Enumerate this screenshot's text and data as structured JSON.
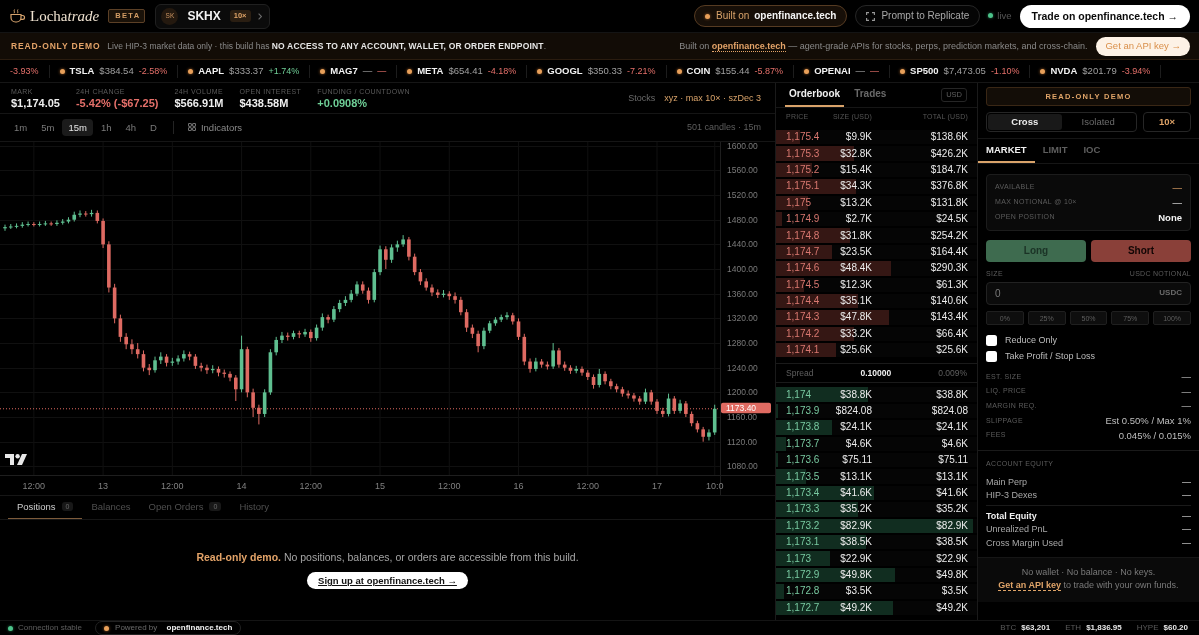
{
  "header": {
    "brand": {
      "upright": "Locha",
      "italic": "trade"
    },
    "badge": "BETA",
    "market": {
      "avatar": "SK",
      "symbol": "SKHX",
      "leverage": "10×"
    },
    "built_on": "Built on **openfinance.tech**",
    "prompt_button": "Prompt to Replicate",
    "live_label": "live",
    "trade_button": "Trade on openfinance.tech →"
  },
  "banner": {
    "tag": "READ-ONLY DEMO",
    "message": "Live HIP-3 market data only · this build has **NO ACCESS TO ANY ACCOUNT, WALLET, OR ORDER ENDPOINT**.",
    "info_prefix": "Built on",
    "info_link": "openfinance.tech",
    "info_suffix": "— agent-grade APIs for stocks, perps, prediction markets, and cross-chain.",
    "button": "Get an API key →"
  },
  "ticker": [
    {
      "change": "-3.93%",
      "positive": false
    },
    {
      "symbol": "TSLA",
      "price": "$384.54",
      "change": "-2.58%",
      "positive": false
    },
    {
      "symbol": "AAPL",
      "price": "$333.37",
      "change": "+1.74%",
      "positive": true
    },
    {
      "symbol": "MAG7",
      "price": "—",
      "change": "—",
      "positive": false
    },
    {
      "symbol": "META",
      "price": "$654.41",
      "change": "-4.18%",
      "positive": false
    },
    {
      "symbol": "GOOGL",
      "price": "$350.33",
      "change": "-7.21%",
      "positive": false
    },
    {
      "symbol": "COIN",
      "price": "$155.44",
      "change": "-5.87%",
      "positive": false
    },
    {
      "symbol": "OPENAI",
      "price": "—",
      "change": "—",
      "positive": false
    },
    {
      "symbol": "SP500",
      "price": "$7,473.05",
      "change": "-1.10%",
      "positive": false
    },
    {
      "symbol": "NVDA",
      "price": "$201.79",
      "change": "-3.94%",
      "positive": false
    }
  ],
  "stats": [
    {
      "label": "MARK",
      "value": "$1,174.05",
      "color": "#efefef"
    },
    {
      "label": "24H CHANGE",
      "value": "-5.42% (-$67.25)",
      "color": "#e5706a"
    },
    {
      "label": "24H VOLUME",
      "value": "$566.91M",
      "color": "#efefef"
    },
    {
      "label": "OPEN INTEREST",
      "value": "$438.58M",
      "color": "#efefef"
    },
    {
      "label": "FUNDING / COUNTDOWN",
      "value": "+0.0908%",
      "color": "#6fcf97"
    }
  ],
  "market_info": {
    "category": "Stocks",
    "details": "xyz · max 10× · szDec 3"
  },
  "chart_toolbar": {
    "timeframes": [
      {
        "label": "1m",
        "selected": false
      },
      {
        "label": "5m",
        "selected": false
      },
      {
        "label": "15m",
        "selected": true
      },
      {
        "label": "1h",
        "selected": false
      },
      {
        "label": "4h",
        "selected": false
      },
      {
        "label": "D",
        "selected": false
      }
    ],
    "indicators_button": "Indicators",
    "candle_count": "501 candles · 15m"
  },
  "chart": {
    "chart_data": {
      "type": "candlestick",
      "categories": [
        null,
        null,
        null,
        null,
        null,
        "12:00",
        null,
        null,
        null,
        null,
        null,
        null,
        null,
        null,
        null,
        null,
        null,
        "13",
        null,
        null,
        null,
        null,
        null,
        null,
        null,
        null,
        null,
        null,
        null,
        "12:00",
        null,
        null,
        null,
        null,
        null,
        null,
        null,
        null,
        null,
        null,
        null,
        "14",
        null,
        null,
        null,
        null,
        null,
        null,
        null,
        null,
        null,
        null,
        null,
        "12:00",
        null,
        null,
        null,
        null,
        null,
        null,
        null,
        null,
        null,
        null,
        null,
        "15",
        null,
        null,
        null,
        null,
        null,
        null,
        null,
        null,
        null,
        null,
        null,
        "12:00",
        null,
        null,
        null,
        null,
        null,
        null,
        null,
        null,
        null,
        null,
        null,
        "16",
        null,
        null,
        null,
        null,
        null,
        null,
        null,
        null,
        null,
        null,
        null,
        "12:00",
        null,
        null,
        null,
        null,
        null,
        null,
        null,
        null,
        null,
        null,
        null,
        "17",
        null,
        null,
        null,
        null,
        null,
        null,
        null,
        null,
        null,
        "10:0"
      ],
      "ohlc": [
        [
          1466,
          1472,
          1462,
          1468
        ],
        [
          1468,
          1473,
          1465,
          1469
        ],
        [
          1469,
          1474,
          1466,
          1470
        ],
        [
          1470,
          1476,
          1467,
          1472
        ],
        [
          1472,
          1477,
          1469,
          1473
        ],
        [
          1473,
          1476,
          1469,
          1472
        ],
        [
          1472,
          1477,
          1469,
          1473
        ],
        [
          1473,
          1478,
          1470,
          1474
        ],
        [
          1474,
          1477,
          1470,
          1473
        ],
        [
          1473,
          1479,
          1470,
          1475
        ],
        [
          1475,
          1481,
          1472,
          1477
        ],
        [
          1477,
          1484,
          1474,
          1480
        ],
        [
          1480,
          1493,
          1477,
          1488
        ],
        [
          1488,
          1495,
          1484,
          1490
        ],
        [
          1490,
          1494,
          1485,
          1489
        ],
        [
          1489,
          1496,
          1485,
          1491
        ],
        [
          1491,
          1495,
          1474,
          1478
        ],
        [
          1478,
          1482,
          1434,
          1440
        ],
        [
          1440,
          1445,
          1362,
          1370
        ],
        [
          1370,
          1376,
          1312,
          1320
        ],
        [
          1320,
          1326,
          1282,
          1290
        ],
        [
          1290,
          1296,
          1270,
          1278
        ],
        [
          1278,
          1286,
          1262,
          1270
        ],
        [
          1270,
          1280,
          1255,
          1262
        ],
        [
          1262,
          1268,
          1234,
          1240
        ],
        [
          1240,
          1246,
          1228,
          1236
        ],
        [
          1236,
          1258,
          1232,
          1252
        ],
        [
          1252,
          1265,
          1246,
          1258
        ],
        [
          1258,
          1262,
          1242,
          1248
        ],
        [
          1248,
          1256,
          1243,
          1250
        ],
        [
          1250,
          1260,
          1245,
          1255
        ],
        [
          1255,
          1268,
          1250,
          1262
        ],
        [
          1262,
          1266,
          1252,
          1258
        ],
        [
          1258,
          1262,
          1238,
          1243
        ],
        [
          1243,
          1248,
          1234,
          1240
        ],
        [
          1240,
          1245,
          1230,
          1236
        ],
        [
          1236,
          1244,
          1231,
          1238
        ],
        [
          1238,
          1242,
          1226,
          1232
        ],
        [
          1232,
          1237,
          1224,
          1230
        ],
        [
          1230,
          1234,
          1218,
          1224
        ],
        [
          1224,
          1228,
          1186,
          1205
        ],
        [
          1205,
          1292,
          1200,
          1270
        ],
        [
          1270,
          1274,
          1192,
          1200
        ],
        [
          1200,
          1206,
          1160,
          1175
        ],
        [
          1175,
          1180,
          1148,
          1165
        ],
        [
          1165,
          1205,
          1160,
          1200
        ],
        [
          1200,
          1270,
          1196,
          1265
        ],
        [
          1265,
          1290,
          1260,
          1285
        ],
        [
          1285,
          1298,
          1280,
          1292
        ],
        [
          1292,
          1297,
          1284,
          1290
        ],
        [
          1290,
          1300,
          1286,
          1296
        ],
        [
          1296,
          1300,
          1288,
          1294
        ],
        [
          1294,
          1303,
          1290,
          1298
        ],
        [
          1298,
          1302,
          1282,
          1288
        ],
        [
          1288,
          1310,
          1284,
          1305
        ],
        [
          1305,
          1328,
          1300,
          1322
        ],
        [
          1322,
          1326,
          1312,
          1318
        ],
        [
          1318,
          1340,
          1314,
          1335
        ],
        [
          1335,
          1350,
          1330,
          1345
        ],
        [
          1345,
          1356,
          1340,
          1350
        ],
        [
          1350,
          1366,
          1346,
          1360
        ],
        [
          1360,
          1380,
          1356,
          1375
        ],
        [
          1375,
          1380,
          1360,
          1365
        ],
        [
          1365,
          1370,
          1344,
          1350
        ],
        [
          1350,
          1400,
          1346,
          1395
        ],
        [
          1395,
          1438,
          1390,
          1432
        ],
        [
          1432,
          1437,
          1400,
          1415
        ],
        [
          1415,
          1440,
          1410,
          1435
        ],
        [
          1435,
          1446,
          1428,
          1440
        ],
        [
          1440,
          1455,
          1436,
          1448
        ],
        [
          1448,
          1452,
          1414,
          1420
        ],
        [
          1420,
          1425,
          1390,
          1395
        ],
        [
          1395,
          1400,
          1374,
          1380
        ],
        [
          1380,
          1385,
          1365,
          1370
        ],
        [
          1370,
          1375,
          1356,
          1362
        ],
        [
          1362,
          1367,
          1353,
          1358
        ],
        [
          1358,
          1366,
          1354,
          1360
        ],
        [
          1360,
          1364,
          1350,
          1356
        ],
        [
          1356,
          1362,
          1344,
          1350
        ],
        [
          1350,
          1355,
          1325,
          1330
        ],
        [
          1330,
          1335,
          1298,
          1305
        ],
        [
          1305,
          1310,
          1288,
          1295
        ],
        [
          1295,
          1300,
          1265,
          1275
        ],
        [
          1275,
          1305,
          1270,
          1300
        ],
        [
          1300,
          1316,
          1296,
          1312
        ],
        [
          1312,
          1322,
          1308,
          1318
        ],
        [
          1318,
          1326,
          1314,
          1322
        ],
        [
          1322,
          1330,
          1318,
          1325
        ],
        [
          1325,
          1329,
          1310,
          1315
        ],
        [
          1315,
          1320,
          1285,
          1290
        ],
        [
          1290,
          1295,
          1244,
          1250
        ],
        [
          1250,
          1255,
          1232,
          1238
        ],
        [
          1238,
          1256,
          1234,
          1250
        ],
        [
          1250,
          1254,
          1240,
          1245
        ],
        [
          1245,
          1250,
          1237,
          1242
        ],
        [
          1242,
          1280,
          1238,
          1268
        ],
        [
          1268,
          1272,
          1240,
          1245
        ],
        [
          1245,
          1250,
          1235,
          1240
        ],
        [
          1240,
          1244,
          1230,
          1235
        ],
        [
          1235,
          1243,
          1231,
          1238
        ],
        [
          1238,
          1242,
          1227,
          1232
        ],
        [
          1232,
          1236,
          1220,
          1225
        ],
        [
          1225,
          1229,
          1206,
          1212
        ],
        [
          1212,
          1238,
          1208,
          1230
        ],
        [
          1230,
          1234,
          1213,
          1218
        ],
        [
          1218,
          1222,
          1205,
          1210
        ],
        [
          1210,
          1214,
          1200,
          1205
        ],
        [
          1205,
          1209,
          1193,
          1198
        ],
        [
          1198,
          1203,
          1190,
          1195
        ],
        [
          1195,
          1199,
          1185,
          1190
        ],
        [
          1190,
          1194,
          1180,
          1185
        ],
        [
          1185,
          1206,
          1181,
          1200
        ],
        [
          1200,
          1204,
          1180,
          1185
        ],
        [
          1185,
          1189,
          1165,
          1170
        ],
        [
          1170,
          1175,
          1160,
          1165
        ],
        [
          1165,
          1198,
          1161,
          1190
        ],
        [
          1190,
          1194,
          1165,
          1170
        ],
        [
          1170,
          1188,
          1166,
          1182
        ],
        [
          1182,
          1186,
          1160,
          1165
        ],
        [
          1165,
          1169,
          1145,
          1150
        ],
        [
          1150,
          1154,
          1135,
          1140
        ],
        [
          1140,
          1144,
          1120,
          1128
        ],
        [
          1128,
          1140,
          1122,
          1135
        ],
        [
          1135,
          1180,
          1131,
          1173.4
        ]
      ],
      "ylim": [
        1066,
        1606
      ],
      "yticks": [
        {
          "value": 1080,
          "label": "1080.00"
        },
        {
          "value": 1120,
          "label": "1120.00"
        },
        {
          "value": 1160,
          "label": "1160.00"
        },
        {
          "value": 1200,
          "label": "1200.00"
        },
        {
          "value": 1240,
          "label": "1240.00"
        },
        {
          "value": 1280,
          "label": "1280.00"
        },
        {
          "value": 1320,
          "label": "1320.00"
        },
        {
          "value": 1360,
          "label": "1360.00"
        },
        {
          "value": 1400,
          "label": "1400.00"
        },
        {
          "value": 1440,
          "label": "1440.00"
        },
        {
          "value": 1480,
          "label": "1480.00"
        },
        {
          "value": 1520,
          "label": "1520.00"
        },
        {
          "value": 1560,
          "label": "1560.00"
        },
        {
          "value": 1600,
          "label": "1600.00"
        }
      ],
      "grid": true,
      "ref_lines": [
        {
          "axis": "y",
          "value": 1173.4,
          "label": "1173.40",
          "color": "#e06b62",
          "line_style": "dotted"
        }
      ]
    }
  },
  "bottom_panel": {
    "tabs": [
      {
        "label": "Positions",
        "count": "0",
        "selected": true
      },
      {
        "label": "Balances",
        "selected": false
      },
      {
        "label": "Open Orders",
        "count": "0",
        "selected": false
      },
      {
        "label": "History",
        "selected": false
      }
    ],
    "notice": "**Read-only demo.** No positions, balances, or orders are accessible from this build.",
    "signup_button": "Sign up at openfinance.tech →"
  },
  "orderbook": {
    "tabs": [
      {
        "label": "Orderbook",
        "selected": true
      },
      {
        "label": "Trades",
        "selected": false
      }
    ],
    "unit_button": "USD",
    "columns": [
      "PRICE",
      "SIZE (USD)",
      "TOTAL (USD)"
    ],
    "asks": [
      {
        "price": "1,175.4",
        "size": "$9.9K",
        "total": "$138.6K",
        "level": 0.12
      },
      {
        "price": "1,175.3",
        "size": "$32.8K",
        "total": "$426.2K",
        "level": 0.39
      },
      {
        "price": "1,175.2",
        "size": "$15.4K",
        "total": "$184.7K",
        "level": 0.18
      },
      {
        "price": "1,175.1",
        "size": "$34.3K",
        "total": "$376.8K",
        "level": 0.4
      },
      {
        "price": "1,175",
        "size": "$13.2K",
        "total": "$131.8K",
        "level": 0.16
      },
      {
        "price": "1,174.9",
        "size": "$2.7K",
        "total": "$24.5K",
        "level": 0.03
      },
      {
        "price": "1,174.8",
        "size": "$31.8K",
        "total": "$254.2K",
        "level": 0.37
      },
      {
        "price": "1,174.7",
        "size": "$23.5K",
        "total": "$164.4K",
        "level": 0.28
      },
      {
        "price": "1,174.6",
        "size": "$48.4K",
        "total": "$290.3K",
        "level": 0.57
      },
      {
        "price": "1,174.5",
        "size": "$12.3K",
        "total": "$61.3K",
        "level": 0.14
      },
      {
        "price": "1,174.4",
        "size": "$35.1K",
        "total": "$140.6K",
        "level": 0.41
      },
      {
        "price": "1,174.3",
        "size": "$47.8K",
        "total": "$143.4K",
        "level": 0.56
      },
      {
        "price": "1,174.2",
        "size": "$33.2K",
        "total": "$66.4K",
        "level": 0.39
      },
      {
        "price": "1,174.1",
        "size": "$25.6K",
        "total": "$25.6K",
        "level": 0.3
      }
    ],
    "spread": {
      "label": "Spread",
      "value": "0.10000",
      "percent": "0.009%"
    },
    "bids": [
      {
        "price": "1,174",
        "size": "$38.8K",
        "total": "$38.8K",
        "level": 0.46
      },
      {
        "price": "1,173.9",
        "size": "$824.08",
        "total": "$824.08",
        "level": 0.01
      },
      {
        "price": "1,173.8",
        "size": "$24.1K",
        "total": "$24.1K",
        "level": 0.28
      },
      {
        "price": "1,173.7",
        "size": "$4.6K",
        "total": "$4.6K",
        "level": 0.05
      },
      {
        "price": "1,173.6",
        "size": "$75.11",
        "total": "$75.11",
        "level": 0.01
      },
      {
        "price": "1,173.5",
        "size": "$13.1K",
        "total": "$13.1K",
        "level": 0.15
      },
      {
        "price": "1,173.4",
        "size": "$41.6K",
        "total": "$41.6K",
        "level": 0.49
      },
      {
        "price": "1,173.3",
        "size": "$35.2K",
        "total": "$35.2K",
        "level": 0.41
      },
      {
        "price": "1,173.2",
        "size": "$82.9K",
        "total": "$82.9K",
        "level": 0.98
      },
      {
        "price": "1,173.1",
        "size": "$38.5K",
        "total": "$38.5K",
        "level": 0.45
      },
      {
        "price": "1,173",
        "size": "$22.9K",
        "total": "$22.9K",
        "level": 0.27
      },
      {
        "price": "1,172.9",
        "size": "$49.8K",
        "total": "$49.8K",
        "level": 0.59
      },
      {
        "price": "1,172.8",
        "size": "$3.5K",
        "total": "$3.5K",
        "level": 0.04
      },
      {
        "price": "1,172.7",
        "size": "$49.2K",
        "total": "$49.2K",
        "level": 0.58
      }
    ]
  },
  "order_panel": {
    "notice": "READ-ONLY DEMO",
    "margin_modes": [
      {
        "label": "Cross",
        "selected": true
      },
      {
        "label": "Isolated",
        "selected": false
      }
    ],
    "leverage_button": "10×",
    "order_types": [
      {
        "label": "MARKET",
        "selected": true
      },
      {
        "label": "LIMIT",
        "selected": false
      },
      {
        "label": "IOC",
        "selected": false
      }
    ],
    "account_info": [
      {
        "label": "AVAILABLE",
        "value": "—",
        "accent": true,
        "emphasis": false
      },
      {
        "label": "MAX NOTIONAL @ 10×",
        "value": "—",
        "accent": false,
        "emphasis": false
      },
      {
        "label": "OPEN POSITION",
        "value": "None",
        "accent": false,
        "emphasis": true
      }
    ],
    "long_button": "Long",
    "short_button": "Short",
    "size_field": {
      "label": "SIZE",
      "unit_label": "USDC NOTIONAL",
      "placeholder": "0",
      "suffix": "USDC"
    },
    "percent_buttons": [
      "0%",
      "25%",
      "50%",
      "75%",
      "100%"
    ],
    "options": [
      {
        "label": "Reduce Only",
        "checked": false
      },
      {
        "label": "Take Profit / Stop Loss",
        "checked": false
      }
    ],
    "estimates": [
      {
        "label": "EST. SIZE",
        "value": "—"
      },
      {
        "label": "LIQ. PRICE",
        "value": "—"
      },
      {
        "label": "MARGIN REQ.",
        "value": "—"
      },
      {
        "label": "SLIPPAGE",
        "value": "Est 0.50% / Max 1%"
      },
      {
        "label": "FEES",
        "value": "0.045% / 0.015%"
      }
    ],
    "equity": {
      "title": "ACCOUNT EQUITY",
      "breakdown": [
        {
          "label": "Main Perp",
          "value": "—",
          "emphasis": false
        },
        {
          "label": "HIP-3 Dexes",
          "value": "—",
          "emphasis": false
        }
      ],
      "totals": [
        {
          "label": "Total Equity",
          "value": "—",
          "emphasis": true
        },
        {
          "label": "Unrealized PnL",
          "value": "—",
          "emphasis": false
        },
        {
          "label": "Cross Margin Used",
          "value": "—",
          "emphasis": false
        }
      ]
    },
    "wallet_note": {
      "line": "No wallet · No balance · No keys.",
      "link": "Get an API key",
      "suffix": "to trade with your own funds."
    }
  },
  "status_bar": {
    "connection": "Connection stable",
    "powered": "Powered by **openfinance.tech**",
    "prices": [
      {
        "symbol": "BTC",
        "price": "$63,201"
      },
      {
        "symbol": "ETH",
        "price": "$1,836.95"
      },
      {
        "symbol": "HYPE",
        "price": "$60.20"
      }
    ]
  }
}
